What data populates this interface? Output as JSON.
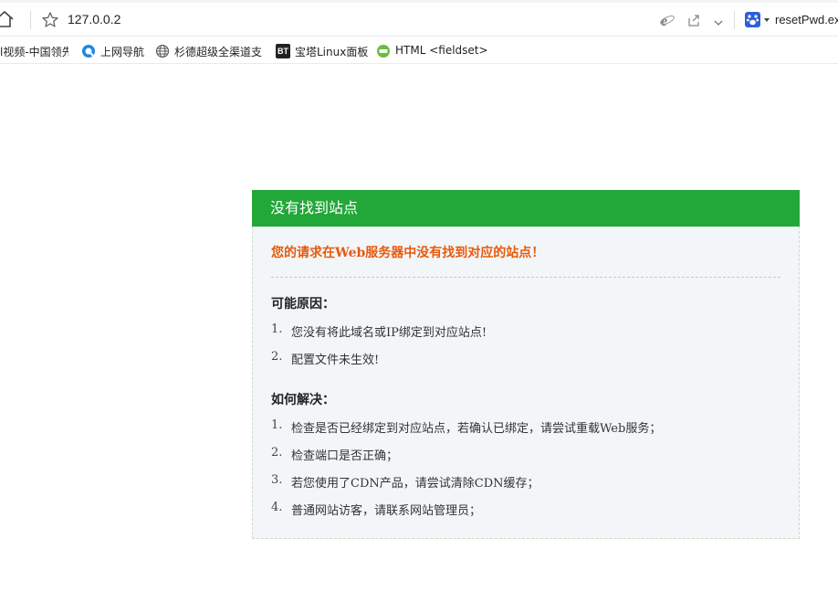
{
  "browser": {
    "url": "127.0.0.2",
    "search_text": "resetPwd.ex",
    "bookmarks": [
      {
        "label": "l视频-中国领先",
        "icon": "video-icon"
      },
      {
        "label": "上网导航",
        "icon": "navigation-icon"
      },
      {
        "label": "杉德超级全渠道支",
        "icon": "globe-icon"
      },
      {
        "label": "宝塔Linux面板",
        "icon": "bt-icon",
        "badge": "BT"
      },
      {
        "label": "HTML <fieldset>",
        "icon": "w3school-icon"
      }
    ]
  },
  "error_panel": {
    "title": "没有找到站点",
    "headline": "您的请求在Web服务器中没有找到对应的站点！",
    "reasons_title": "可能原因：",
    "reasons": [
      {
        "num": "1.",
        "text": "您没有将此域名或IP绑定到对应站点!"
      },
      {
        "num": "2.",
        "text": "配置文件未生效!"
      }
    ],
    "solutions_title": "如何解决：",
    "solutions": [
      {
        "num": "1.",
        "text": "检查是否已经绑定到对应站点，若确认已绑定，请尝试重载Web服务；"
      },
      {
        "num": "2.",
        "text": "检查端口是否正确；"
      },
      {
        "num": "3.",
        "text": "若您使用了CDN产品，请尝试清除CDN缓存；"
      },
      {
        "num": "4.",
        "text": "普通网站访客，请联系网站管理员；"
      }
    ]
  },
  "colors": {
    "header_green": "#22a739",
    "headline_orange": "#e8590c",
    "panel_bg": "#f2f6f8"
  }
}
